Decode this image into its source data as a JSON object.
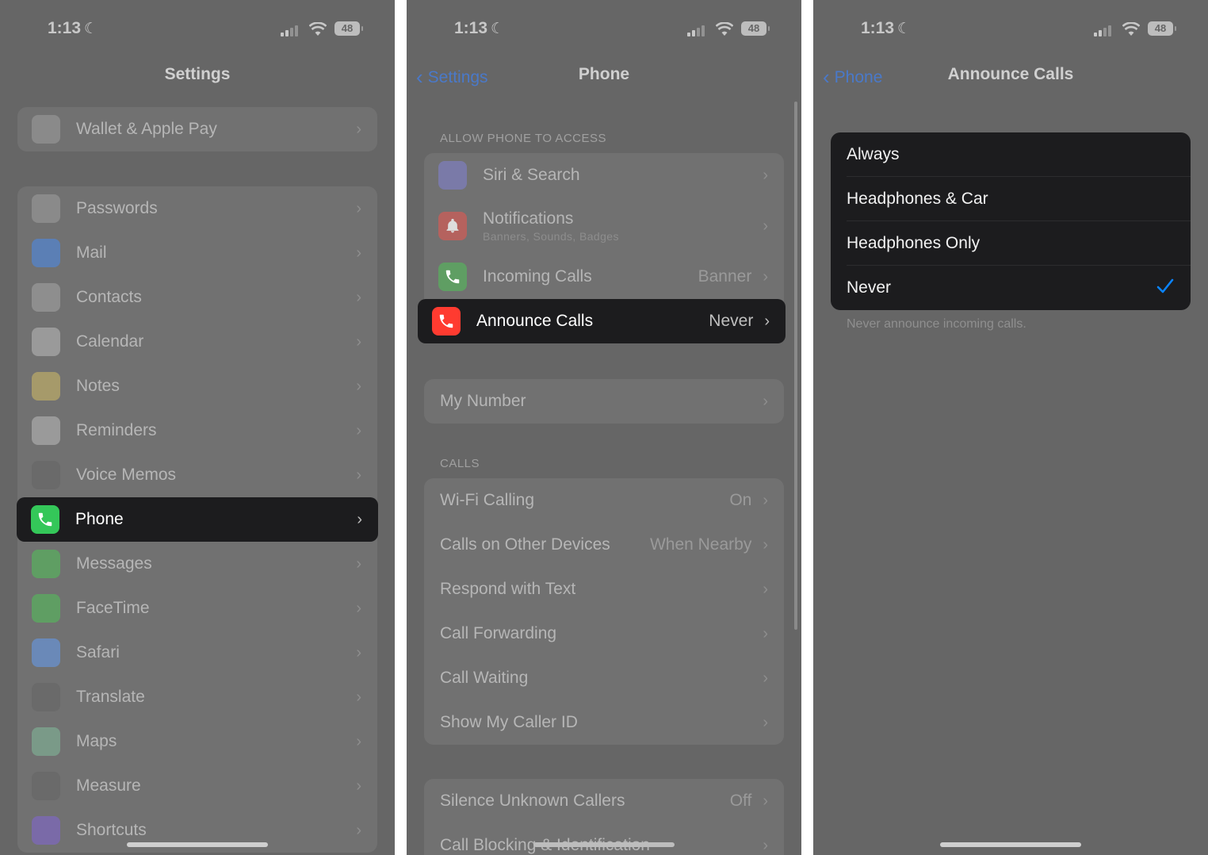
{
  "status": {
    "time": "1:13",
    "battery": "48"
  },
  "screen1": {
    "title": "Settings",
    "top_item": {
      "label": "Wallet & Apple Pay",
      "icon": "wallet-icon",
      "color": "#8a8a8a"
    },
    "items": [
      {
        "label": "Passwords",
        "icon": "key-icon",
        "color": "#8a8a8a"
      },
      {
        "label": "Mail",
        "icon": "mail-icon",
        "color": "#5b7fb5"
      },
      {
        "label": "Contacts",
        "icon": "contacts-icon",
        "color": "#8e8e8e"
      },
      {
        "label": "Calendar",
        "icon": "calendar-icon",
        "color": "#9a9a9a"
      },
      {
        "label": "Notes",
        "icon": "notes-icon",
        "color": "#a69a6a"
      },
      {
        "label": "Reminders",
        "icon": "reminders-icon",
        "color": "#9a9a9a"
      },
      {
        "label": "Voice Memos",
        "icon": "voice-memos-icon",
        "color": "#6a6a6a"
      },
      {
        "label": "Phone",
        "icon": "phone-icon",
        "color": "#34c759",
        "selected": true
      },
      {
        "label": "Messages",
        "icon": "messages-icon",
        "color": "#5f9e63"
      },
      {
        "label": "FaceTime",
        "icon": "facetime-icon",
        "color": "#5f9e63"
      },
      {
        "label": "Safari",
        "icon": "safari-icon",
        "color": "#6a89b8"
      },
      {
        "label": "Translate",
        "icon": "translate-icon",
        "color": "#6a6a6a"
      },
      {
        "label": "Maps",
        "icon": "maps-icon",
        "color": "#7a9a88"
      },
      {
        "label": "Measure",
        "icon": "measure-icon",
        "color": "#6a6a6a"
      },
      {
        "label": "Shortcuts",
        "icon": "shortcuts-icon",
        "color": "#7a6aa8"
      }
    ]
  },
  "screen2": {
    "back": "Settings",
    "title": "Phone",
    "section_access": "ALLOW PHONE TO ACCESS",
    "access_items": [
      {
        "label": "Siri & Search",
        "icon": "siri-icon",
        "color": "#7a7aa8"
      },
      {
        "label": "Notifications",
        "sub": "Banners, Sounds, Badges",
        "icon": "bell-icon",
        "color": "#b5625e"
      },
      {
        "label": "Incoming Calls",
        "value": "Banner",
        "icon": "incoming-call-icon",
        "color": "#5f9e63"
      },
      {
        "label": "Announce Calls",
        "value": "Never",
        "icon": "announce-calls-icon",
        "color": "#ff3b30",
        "selected": true
      }
    ],
    "my_number": "My Number",
    "section_calls": "CALLS",
    "calls_items": [
      {
        "label": "Wi-Fi Calling",
        "value": "On"
      },
      {
        "label": "Calls on Other Devices",
        "value": "When Nearby"
      },
      {
        "label": "Respond with Text",
        "value": ""
      },
      {
        "label": "Call Forwarding",
        "value": ""
      },
      {
        "label": "Call Waiting",
        "value": ""
      },
      {
        "label": "Show My Caller ID",
        "value": ""
      }
    ],
    "bottom_items": [
      {
        "label": "Silence Unknown Callers",
        "value": "Off"
      },
      {
        "label": "Call Blocking & Identification",
        "value": ""
      }
    ]
  },
  "screen3": {
    "back": "Phone",
    "title": "Announce Calls",
    "options": [
      "Always",
      "Headphones & Car",
      "Headphones Only",
      "Never"
    ],
    "selected": "Never",
    "footnote": "Never announce incoming calls.",
    "check_color": "#0a84ff"
  }
}
